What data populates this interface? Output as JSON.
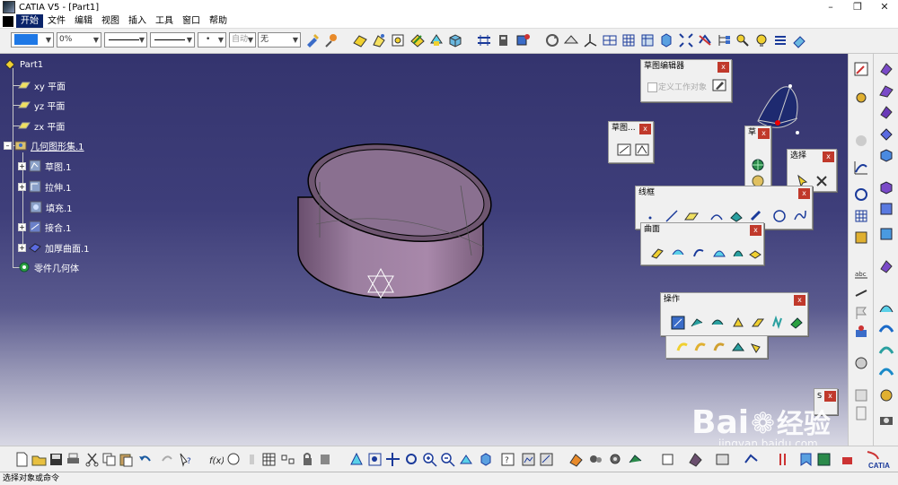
{
  "window": {
    "title": "CATIA V5 - [Part1]"
  },
  "menu": [
    "开始",
    "文件",
    "编辑",
    "视图",
    "插入",
    "工具",
    "窗口",
    "帮助"
  ],
  "toolbar": {
    "transparency": "0%",
    "line_weight_box": "自动",
    "layer": "无"
  },
  "tree": {
    "root": "Part1",
    "xy": "xy 平面",
    "yz": "yz 平面",
    "zx": "zx 平面",
    "geoset": "几何图形集.1",
    "items": [
      "草图.1",
      "拉伸.1",
      "填充.1",
      "接合.1",
      "加厚曲面.1"
    ],
    "body": "零件几何体"
  },
  "panels": {
    "sketcher": {
      "title": "草图编辑器",
      "checkbox": "定义工作对象"
    },
    "sketch": {
      "title": "草图..."
    },
    "small1": {
      "title": "草"
    },
    "select": {
      "title": "选择"
    },
    "wireframe": {
      "title": "线框"
    },
    "surfaces": {
      "title": "曲面"
    },
    "operations": {
      "title": "操作"
    },
    "small2": {
      "title": "S"
    }
  },
  "close_label": "x",
  "status": "选择对象或命令",
  "watermark": {
    "brand": "Bai",
    "brand2": "经验",
    "url": "jingyan.baidu.com"
  },
  "catia_logo": "CATIA"
}
